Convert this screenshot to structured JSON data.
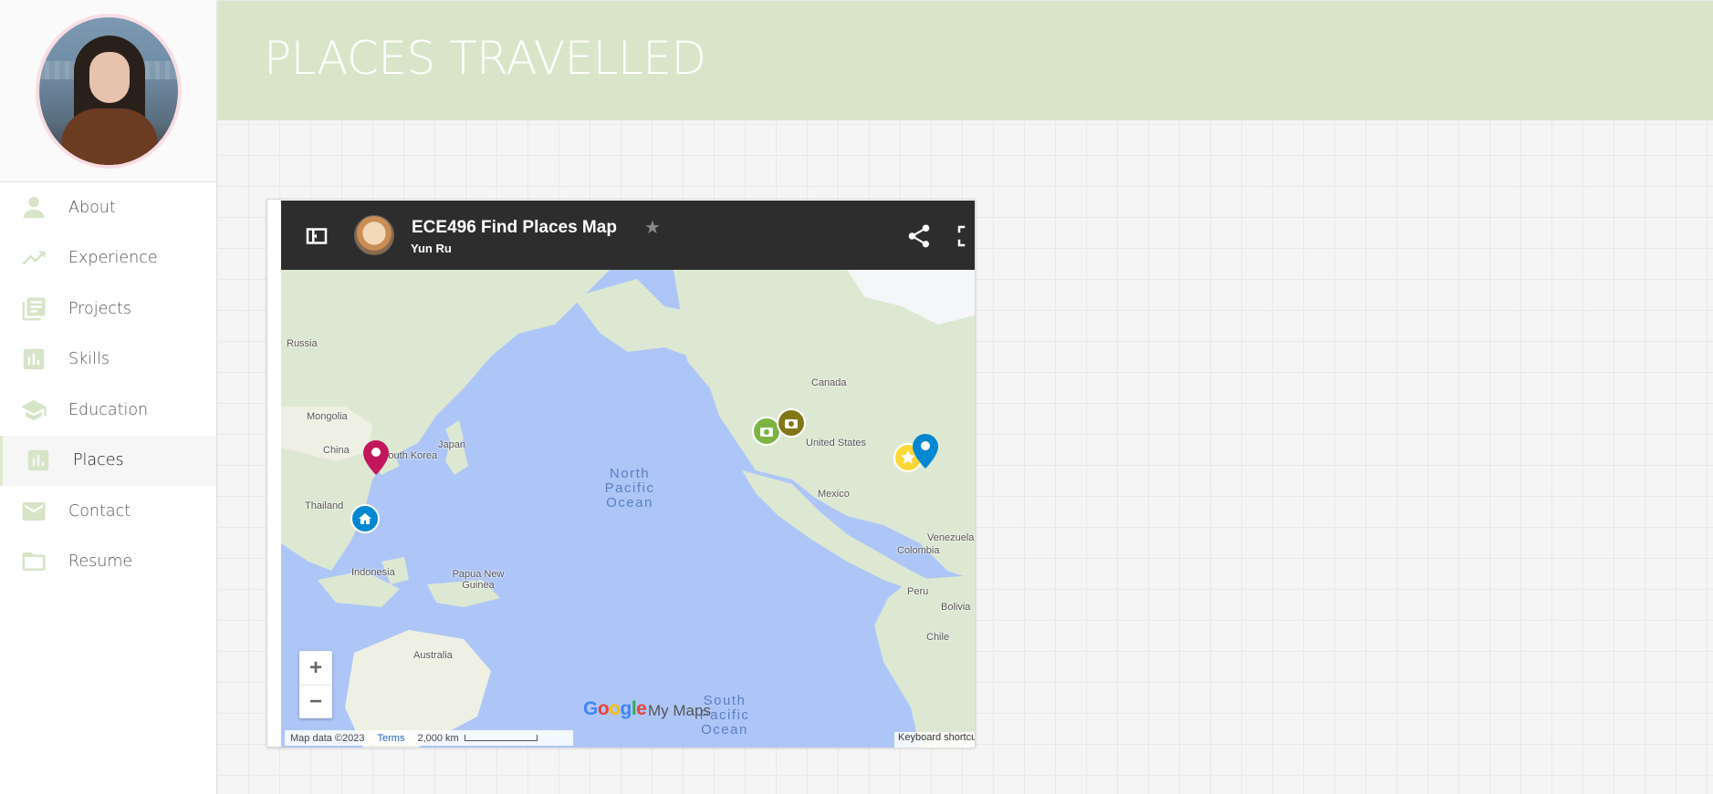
{
  "header": {
    "title": "PLACES TRAVELLED"
  },
  "colors": {
    "accent": "#d9e5c9",
    "icon": "#d6e4c7",
    "map_bar": "#2d2d2d"
  },
  "sidebar": {
    "items": [
      {
        "label": "About",
        "icon": "person-icon"
      },
      {
        "label": "Experience",
        "icon": "trending-up-icon"
      },
      {
        "label": "Projects",
        "icon": "document-stack-icon"
      },
      {
        "label": "Skills",
        "icon": "bar-chart-icon"
      },
      {
        "label": "Education",
        "icon": "graduation-cap-icon"
      },
      {
        "label": "Places",
        "icon": "bar-chart-icon",
        "active": true
      },
      {
        "label": "Contact",
        "icon": "mail-icon"
      },
      {
        "label": "Resume",
        "icon": "folder-icon"
      }
    ]
  },
  "map": {
    "title": "ECE496 Find Places Map",
    "author": "Yun Ru",
    "labels": {
      "russia": "Russia",
      "mongolia": "Mongolia",
      "china": "China",
      "japan": "Japan",
      "south_korea": "South Korea",
      "thailand": "Thailand",
      "indonesia": "Indonesia",
      "papua": "Papua New Guinea",
      "australia": "Australia",
      "canada": "Canada",
      "united_states": "United States",
      "mexico": "Mexico",
      "venezuela": "Venezuela",
      "colombia": "Colombia",
      "peru": "Peru",
      "bolivia": "Bolivia",
      "chile": "Chile"
    },
    "oceans": {
      "north_pacific": "North Pacific Ocean",
      "south_pacific": "South Pacific Ocean"
    },
    "branding": {
      "google": "Google",
      "mymaps": "My Maps"
    },
    "attribution": {
      "map_data": "Map data ©2023",
      "terms": "Terms",
      "scale": "2,000 km",
      "keyboard": "Keyboard shortcuts"
    },
    "zoom": {
      "in": "+",
      "out": "−"
    }
  }
}
